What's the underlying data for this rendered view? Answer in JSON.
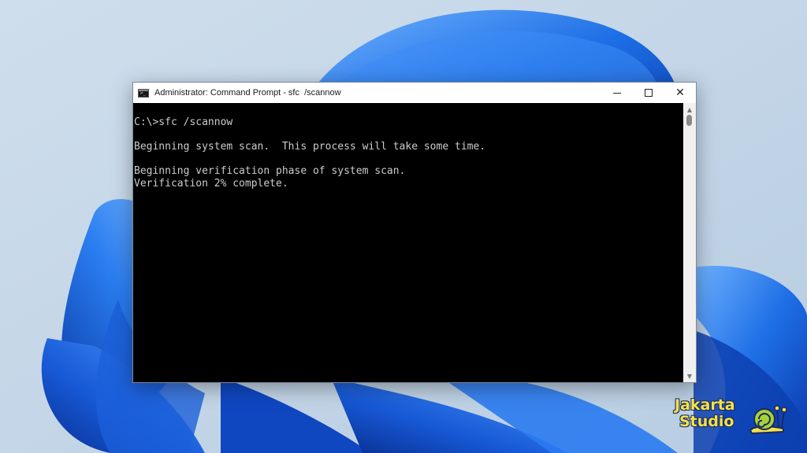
{
  "window": {
    "title": "Administrator: Command Prompt - sfc  /scannow",
    "icon": "cmd-icon",
    "controls": {
      "minimize": "minimize-icon",
      "maximize": "maximize-icon",
      "close": "close-icon"
    }
  },
  "console": {
    "lines": [
      "C:\\>sfc /scannow",
      "",
      "Beginning system scan.  This process will take some time.",
      "",
      "Beginning verification phase of system scan.",
      "Verification 2% complete."
    ],
    "text_color": "#cccccc",
    "background": "#000000"
  },
  "watermark": {
    "line1": "Jakarta",
    "line2": "Studio",
    "logo": "snail-logo",
    "text_color": "#f3e24a"
  },
  "wallpaper": {
    "theme": "windows-11-bloom",
    "colors": [
      "#c9d9e8",
      "#1f6fe0",
      "#0a3fb8"
    ]
  }
}
